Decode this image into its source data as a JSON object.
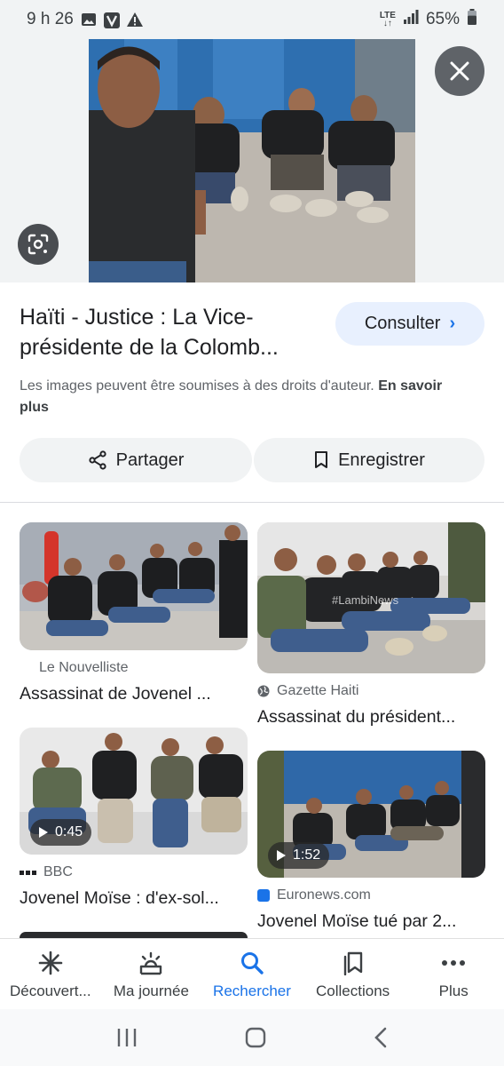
{
  "status_bar": {
    "time": "9 h 26",
    "network": "LTE",
    "battery": "65%"
  },
  "hero": {
    "image_alt": "Men in dark shirts seated on floor"
  },
  "detail": {
    "title": "Haïti - Justice : La Vice-présidente de la Colomb...",
    "consult_label": "Consulter",
    "rights_text": "Les images peuvent être soumises à des droits d'auteur.",
    "rights_link": "En savoir plus",
    "share_label": "Partager",
    "save_label": "Enregistrer"
  },
  "results": [
    {
      "source": "Le Nouvelliste",
      "title": "Assassinat de Jovenel ...",
      "duration": ""
    },
    {
      "source": "Gazette Haiti",
      "title": "Assassinat du président...",
      "duration": "",
      "watermark": "#LambiNews"
    },
    {
      "source": "BBC",
      "title": "Jovenel Moïse : d'ex-sol...",
      "duration": "0:45"
    },
    {
      "source": "Euronews.com",
      "title": "Jovenel Moïse tué par 2...",
      "duration": "1:52"
    }
  ],
  "bottom_nav": [
    {
      "label": "Découvert...",
      "icon": "asterisk-icon"
    },
    {
      "label": "Ma journée",
      "icon": "sunrise-icon"
    },
    {
      "label": "Rechercher",
      "icon": "search-icon",
      "active": true
    },
    {
      "label": "Collections",
      "icon": "collections-icon"
    },
    {
      "label": "Plus",
      "icon": "more-icon"
    }
  ],
  "colors": {
    "accent": "#1a73e8",
    "consult_bg": "#e8f0fe",
    "chip_bg": "#f1f3f4"
  }
}
